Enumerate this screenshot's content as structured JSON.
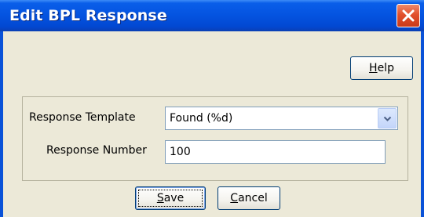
{
  "window": {
    "title": "Edit BPL Response",
    "close_icon": "close-icon",
    "accent": "#0a52d8",
    "close_color": "#e2502c"
  },
  "toolbar": {
    "help_prefix": "",
    "help_mnemonic": "H",
    "help_rest": "elp"
  },
  "form": {
    "response_template_label": "Response Template",
    "response_template_value": "Found (%d)",
    "dropdown_icon": "chevron-down-icon",
    "response_number_label": "Response Number",
    "response_number_value": "100"
  },
  "actions": {
    "save_mnemonic": "S",
    "save_rest": "ave",
    "cancel_mnemonic": "C",
    "cancel_rest": "ancel"
  }
}
